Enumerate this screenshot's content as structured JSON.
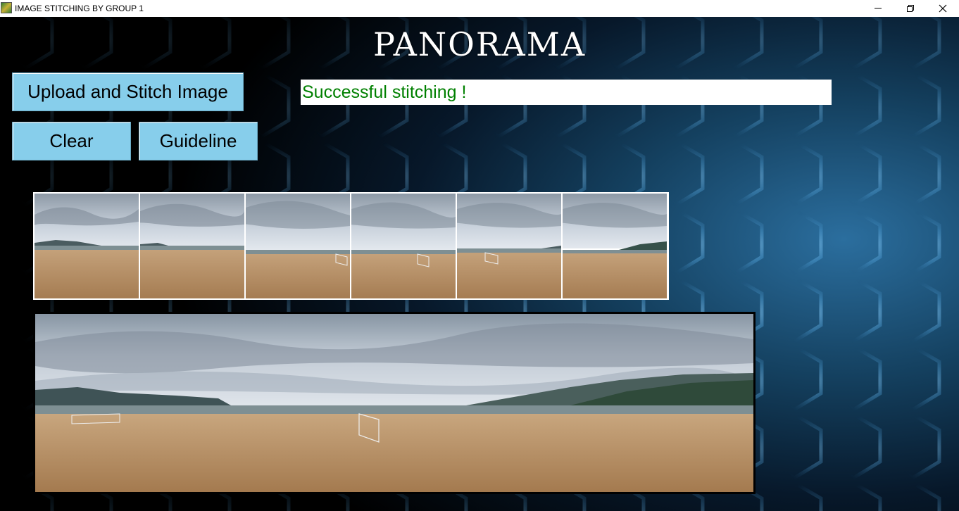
{
  "window": {
    "title": "IMAGE STITCHING BY GROUP 1",
    "app_icon": "app-icon",
    "controls": {
      "minimize_icon": "minimize-icon",
      "maximize_icon": "restore-icon",
      "close_icon": "close-icon"
    }
  },
  "header": {
    "title": "PANORAMA"
  },
  "buttons": {
    "upload": "Upload and Stitch Image",
    "clear": "Clear",
    "guideline": "Guideline"
  },
  "status": {
    "text": "Successful stitching !",
    "color": "#008000"
  },
  "colors": {
    "button_bg": "#87ceeb",
    "background_glow": "#2b6e9e"
  },
  "input_images": {
    "count_shown": 6
  },
  "result": {
    "description_icon": "panorama-image"
  }
}
